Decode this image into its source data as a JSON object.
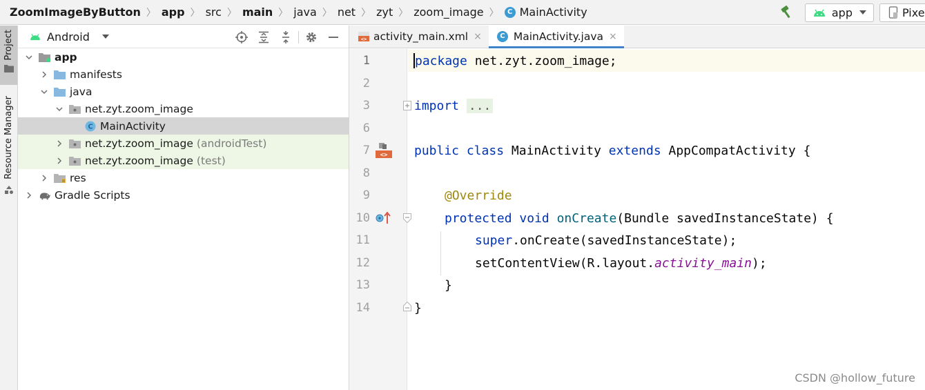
{
  "breadcrumbs": {
    "project": "ZoomImageByButton",
    "items": [
      "app",
      "src",
      "main",
      "java",
      "net",
      "zyt",
      "zoom_image"
    ],
    "current": "MainActivity"
  },
  "toolbar": {
    "run_config": "app",
    "device": "Pixel"
  },
  "left_strip": {
    "project_tab": "Project",
    "resource_tab": "Resource Manager"
  },
  "project_panel": {
    "view_mode": "Android",
    "tree": [
      {
        "label": "app",
        "suffix": ""
      },
      {
        "label": "manifests",
        "suffix": ""
      },
      {
        "label": "java",
        "suffix": ""
      },
      {
        "label": "net.zyt.zoom_image",
        "suffix": ""
      },
      {
        "label": "MainActivity",
        "suffix": ""
      },
      {
        "label": "net.zyt.zoom_image",
        "suffix": "(androidTest)"
      },
      {
        "label": "net.zyt.zoom_image",
        "suffix": "(test)"
      },
      {
        "label": "res",
        "suffix": ""
      },
      {
        "label": "Gradle Scripts",
        "suffix": ""
      }
    ]
  },
  "editor": {
    "tabs": [
      {
        "label": "activity_main.xml",
        "close": "×"
      },
      {
        "label": "MainActivity.java",
        "close": "×"
      }
    ],
    "line_numbers": [
      "1",
      "2",
      "3",
      "6",
      "7",
      "8",
      "9",
      "10",
      "11",
      "12",
      "13",
      "14"
    ],
    "code": {
      "l1_kw": "package",
      "l1_rest": " net.zyt.zoom_image;",
      "l3_kw": "import",
      "l3_fold": "...",
      "l7_kw1": "public",
      "l7_kw2": "class",
      "l7_name": "MainActivity",
      "l7_kw3": "extends",
      "l7_super": "AppCompatActivity {",
      "l9_ann": "@Override",
      "l10_kw1": "protected",
      "l10_kw2": "void",
      "l10_fn": "onCreate",
      "l10_rest": "(Bundle savedInstanceState) {",
      "l11_kw": "super",
      "l11_rest": ".onCreate(savedInstanceState);",
      "l12_a": "setContentView(R.layout.",
      "l12_field": "activity_main",
      "l12_b": ");",
      "l13": "}",
      "l14": "}"
    }
  },
  "watermark": "CSDN @hollow_future",
  "colors": {
    "keyword": "#0033b3",
    "annotation": "#9e880d",
    "method": "#00627a",
    "field": "#871094",
    "android_green": "#3ddc84",
    "tab_underline": "#4083c9"
  }
}
